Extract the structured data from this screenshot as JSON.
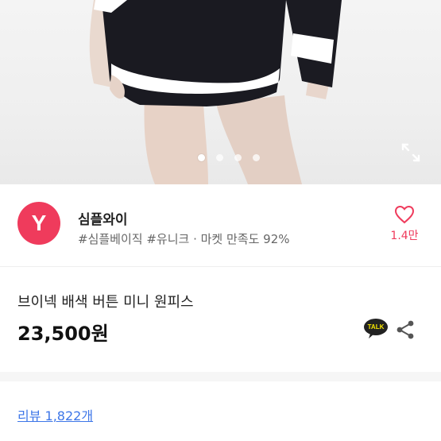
{
  "gallery": {
    "slide_count": 4,
    "active_index": 0,
    "expand_icon": "expand-icon"
  },
  "seller": {
    "logo_letter": "Y",
    "name": "심플와이",
    "meta": "#심플베이직 #유니크 · 마켓 만족도 92%",
    "like_count": "1.4만",
    "like_icon": "heart-icon",
    "brand_color": "#ef3b5c"
  },
  "product": {
    "name": "브이넥 배색 버튼 미니 원피스",
    "price": "23,500원",
    "kakao_label": "TALK",
    "share_icon": "share-icon"
  },
  "reviews": {
    "link_label": "리뷰 1,822개",
    "link_color": "#3d76e8"
  }
}
